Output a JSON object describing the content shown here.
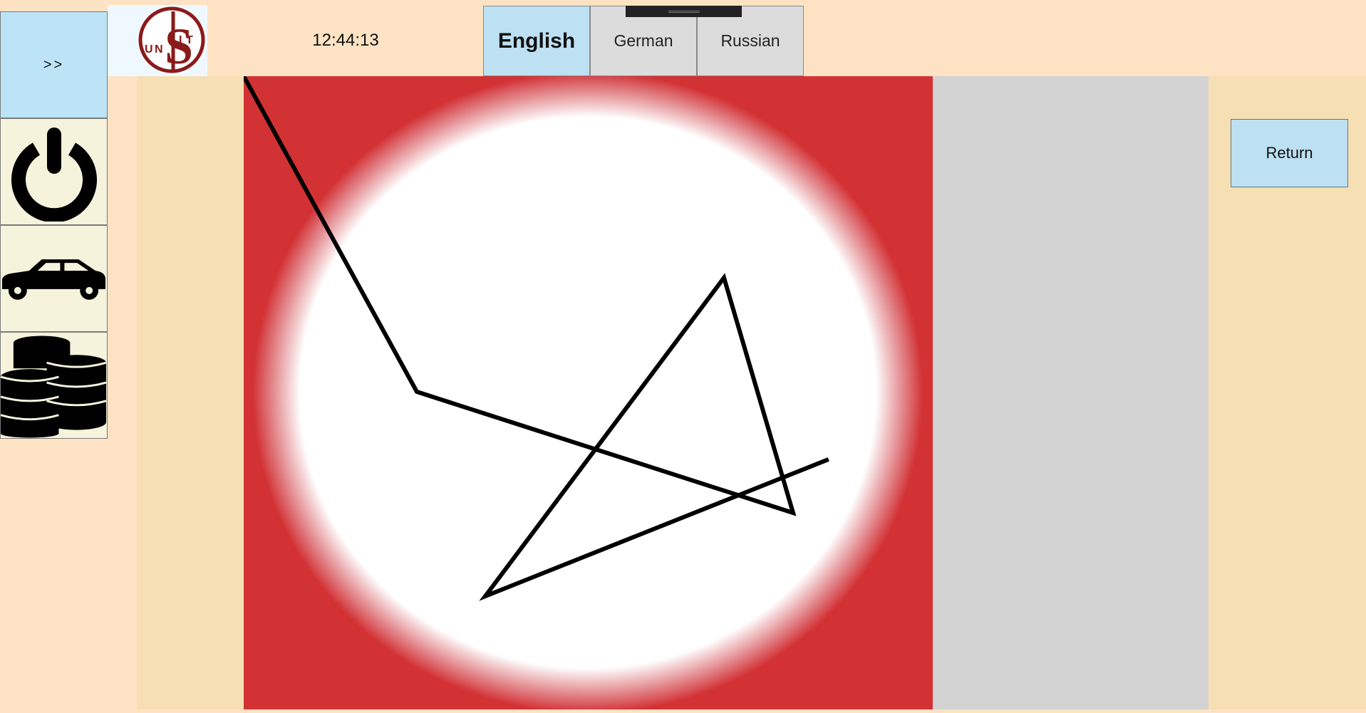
{
  "header": {
    "clock": "12:44:13",
    "logo_text": "UNSIT",
    "languages": [
      {
        "label": "English",
        "selected": true
      },
      {
        "label": "German",
        "selected": false
      },
      {
        "label": "Russian",
        "selected": false
      }
    ]
  },
  "sidebar": {
    "expand_label": ">>",
    "items": [
      {
        "icon": "power-icon"
      },
      {
        "icon": "car-icon"
      },
      {
        "icon": "coins-icon"
      }
    ]
  },
  "main": {
    "return_label": "Return"
  },
  "colors": {
    "background": "#fde3c3",
    "selected_language": "#bde0f2",
    "canvas_edge": "#d33235",
    "logo": "#8b1a1a"
  }
}
